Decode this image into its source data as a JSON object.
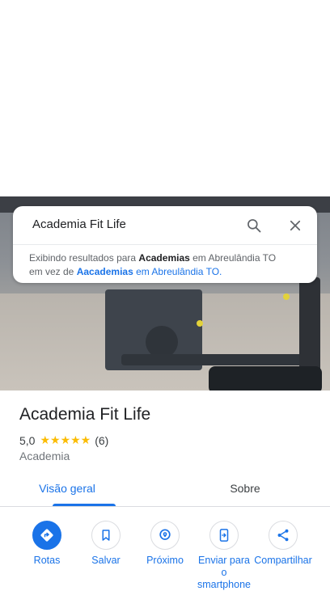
{
  "search": {
    "query": "Academia Fit Life"
  },
  "notice": {
    "prefix": "Exibindo resultados para ",
    "bold_term": "Academias",
    "mid": " em Abreulândia TO",
    "line2_prefix": "em vez de ",
    "alt_term": "Aacademias",
    "alt_suffix": " em Abreulândia TO."
  },
  "place": {
    "title": "Academia Fit Life",
    "rating": "5,0",
    "stars": "★★★★★",
    "review_count": "(6)",
    "category": "Academia"
  },
  "tabs": [
    {
      "label": "Visão geral",
      "active": true
    },
    {
      "label": "Sobre",
      "active": false
    }
  ],
  "actions": [
    {
      "label": "Rotas",
      "icon": "directions-icon"
    },
    {
      "label": "Salvar",
      "icon": "bookmark-icon"
    },
    {
      "label": "Próximo",
      "icon": "nearby-icon"
    },
    {
      "label": "Enviar para o smartphone",
      "icon": "send-to-phone-icon"
    },
    {
      "label": "Compartilhar",
      "icon": "share-icon"
    }
  ],
  "colors": {
    "accent": "#1a73e8",
    "star": "#fbbc04"
  }
}
